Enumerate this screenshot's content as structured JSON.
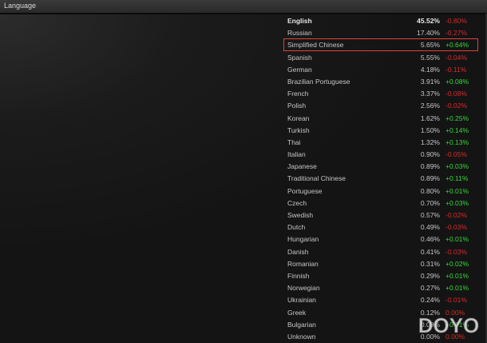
{
  "panel": {
    "title": "Language"
  },
  "languages": [
    {
      "name": "English",
      "percent": "45.52%",
      "change": "-0.80%",
      "dir": "neg",
      "bold": true
    },
    {
      "name": "Russian",
      "percent": "17.40%",
      "change": "-0.27%",
      "dir": "neg"
    },
    {
      "name": "Simplified Chinese",
      "percent": "5.65%",
      "change": "+0.64%",
      "dir": "pos",
      "highlighted": true
    },
    {
      "name": "Spanish",
      "percent": "5.55%",
      "change": "-0.04%",
      "dir": "neg"
    },
    {
      "name": "German",
      "percent": "4.18%",
      "change": "-0.11%",
      "dir": "neg"
    },
    {
      "name": "Brazilian Portuguese",
      "percent": "3.91%",
      "change": "+0.08%",
      "dir": "pos"
    },
    {
      "name": "French",
      "percent": "3.37%",
      "change": "-0.08%",
      "dir": "neg"
    },
    {
      "name": "Polish",
      "percent": "2.56%",
      "change": "-0.02%",
      "dir": "neg"
    },
    {
      "name": "Korean",
      "percent": "1.62%",
      "change": "+0.25%",
      "dir": "pos"
    },
    {
      "name": "Turkish",
      "percent": "1.50%",
      "change": "+0.14%",
      "dir": "pos"
    },
    {
      "name": "Thai",
      "percent": "1.32%",
      "change": "+0.13%",
      "dir": "pos"
    },
    {
      "name": "Italian",
      "percent": "0.90%",
      "change": "-0.05%",
      "dir": "neg"
    },
    {
      "name": "Japanese",
      "percent": "0.89%",
      "change": "+0.03%",
      "dir": "pos"
    },
    {
      "name": "Traditional Chinese",
      "percent": "0.89%",
      "change": "+0.11%",
      "dir": "pos"
    },
    {
      "name": "Portuguese",
      "percent": "0.80%",
      "change": "+0.01%",
      "dir": "pos"
    },
    {
      "name": "Czech",
      "percent": "0.70%",
      "change": "+0.03%",
      "dir": "pos"
    },
    {
      "name": "Swedish",
      "percent": "0.57%",
      "change": "-0.02%",
      "dir": "neg"
    },
    {
      "name": "Dutch",
      "percent": "0.49%",
      "change": "-0.03%",
      "dir": "neg"
    },
    {
      "name": "Hungarian",
      "percent": "0.46%",
      "change": "+0.01%",
      "dir": "pos"
    },
    {
      "name": "Danish",
      "percent": "0.41%",
      "change": "-0.03%",
      "dir": "neg"
    },
    {
      "name": "Romanian",
      "percent": "0.31%",
      "change": "+0.02%",
      "dir": "pos"
    },
    {
      "name": "Finnish",
      "percent": "0.29%",
      "change": "+0.01%",
      "dir": "pos"
    },
    {
      "name": "Norwegian",
      "percent": "0.27%",
      "change": "+0.01%",
      "dir": "pos"
    },
    {
      "name": "Ukrainian",
      "percent": "0.24%",
      "change": "-0.01%",
      "dir": "neg"
    },
    {
      "name": "Greek",
      "percent": "0.12%",
      "change": "0.00%",
      "dir": "neg"
    },
    {
      "name": "Bulgarian",
      "percent": "0.09%",
      "change": "+0.01%",
      "dir": "pos"
    },
    {
      "name": "Unknown",
      "percent": "0.00%",
      "change": "0.00%",
      "dir": "neg"
    }
  ],
  "colors": {
    "positive": "#38d73a",
    "negative": "#d72a2a",
    "highlight_border": "#e0413a"
  },
  "watermark": {
    "text": "DOYO"
  }
}
